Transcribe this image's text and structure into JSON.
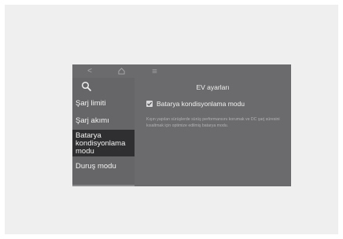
{
  "nav": {
    "back_glyph": "<",
    "home_icon": "home-icon",
    "menu_icon": "menu-icon"
  },
  "header": {
    "title": "EV ayarları"
  },
  "sidebar": {
    "search_icon": "search-icon",
    "items": [
      {
        "label": "Şarj limiti",
        "active": false
      },
      {
        "label": "Şarj akımı",
        "active": false
      },
      {
        "label": "Batarya kondisyonlama modu",
        "active": true
      },
      {
        "label": "Duruş modu",
        "active": false
      }
    ]
  },
  "main": {
    "checkbox": {
      "label": "Batarya kondisyonlama modu",
      "checked": true
    },
    "description": "Kışın yapılan sürüşlerde sürüş performansını korumak ve DC şarj süresini kısaltmak için optimize edilmiş batarya modu."
  },
  "colors": {
    "screen_bg": "#6b6b6d",
    "active_item_bg": "#2f2f31",
    "text_primary": "#f2f2f2",
    "text_muted": "#b3b3b5"
  }
}
